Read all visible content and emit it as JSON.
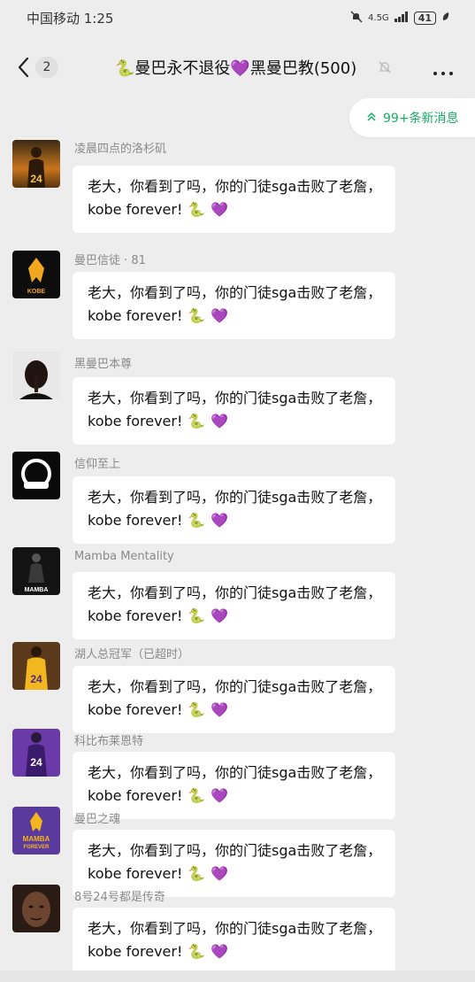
{
  "status_bar": {
    "carrier_time": "中国移动 1:25",
    "network": "4.5G",
    "battery": "41"
  },
  "nav": {
    "back_count": "2",
    "title": "🐍曼巴永不退役💜黑曼巴教(500)"
  },
  "new_messages": {
    "label": "99+条新消息"
  },
  "messages": [
    {
      "sender": "凌晨四点的洛杉矶",
      "avatar": "kobe-24-sunset-avatar",
      "line1": "老大，你看到了吗，你的门徒sga击败了老詹，",
      "line2": "kobe forever!",
      "emoji1": "🐍",
      "emoji2": "💜"
    },
    {
      "sender": "曼巴信徒 · 81",
      "avatar": "kobe-logo-avatar",
      "line1": "老大，你看到了吗，你的门徒sga击败了老詹，",
      "line2": "kobe forever!",
      "emoji1": "🐍",
      "emoji2": "💜"
    },
    {
      "sender": "黑曼巴本尊",
      "avatar": "kobe-portrait-avatar",
      "line1": "老大，你看到了吗，你的门徒sga击败了老詹，",
      "line2": "kobe forever!",
      "emoji1": "🐍",
      "emoji2": "💜"
    },
    {
      "sender": "信仰至上",
      "avatar": "ring-logo-avatar",
      "line1": "老大，你看到了吗，你的门徒sga击败了老詹，",
      "line2": "kobe forever!",
      "emoji1": "🐍",
      "emoji2": "💜"
    },
    {
      "sender": "Mamba Mentality",
      "avatar": "mamba-silhouette-avatar",
      "line1": "老大，你看到了吗，你的门徒sga击败了老詹，",
      "line2": "kobe forever!",
      "emoji1": "🐍",
      "emoji2": "💜"
    },
    {
      "sender": "湖人总冠军（已超时）",
      "avatar": "lakers-24-avatar",
      "line1": "老大，你看到了吗，你的门徒sga击败了老詹，",
      "line2": "kobe forever!",
      "emoji1": "🐍",
      "emoji2": "💜"
    },
    {
      "sender": "科比布莱恩特",
      "avatar": "purple-jersey-avatar",
      "line1": "老大，你看到了吗，你的门徒sga击败了老詹，",
      "line2": "kobe forever!",
      "emoji1": "🐍",
      "emoji2": "💜"
    },
    {
      "sender": "曼巴之魂",
      "avatar": "mamba-forever-avatar",
      "line1": "老大，你看到了吗，你的门徒sga击败了老詹，",
      "line2": "kobe forever!",
      "emoji1": "🐍",
      "emoji2": "💜"
    },
    {
      "sender": "8号24号都是传奇",
      "avatar": "face-portrait-avatar",
      "line1": "老大，你看到了吗，你的门徒sga击败了老詹，",
      "line2": "kobe forever!",
      "emoji1": "🐍",
      "emoji2": "💜"
    }
  ],
  "avatar_texts": {
    "kobe_logo": "KOBE",
    "jersey_24": "24",
    "mamba": "MAMBA",
    "mamba_forever_1": "MAMBA",
    "mamba_forever_2": "FOREVER"
  },
  "colors": {
    "background": "#ededed",
    "bubble": "#ffffff",
    "accent_green": "#1aad6a",
    "sender_gray": "#8a8a8a"
  }
}
